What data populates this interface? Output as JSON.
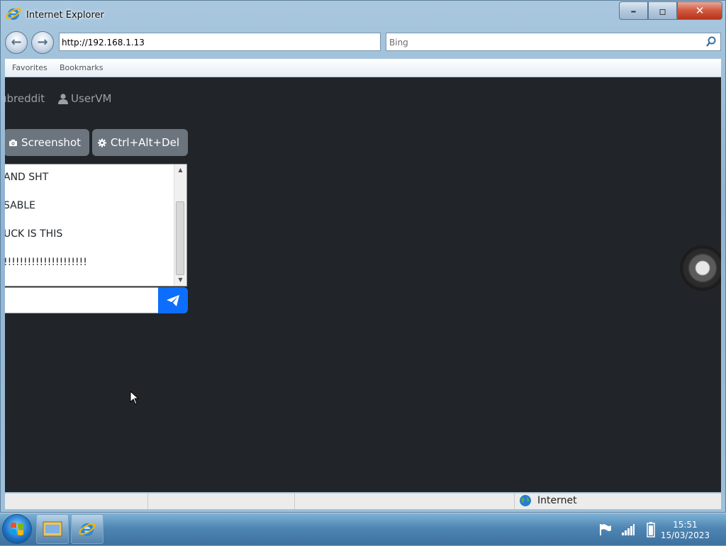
{
  "window": {
    "title": "Internet Explorer",
    "buttons": {
      "minimize": "–",
      "maximize": "▫",
      "close": "✕"
    }
  },
  "nav": {
    "back": "←",
    "forward": "→",
    "address": "http://192.168.1.13",
    "search_placeholder": "Bing"
  },
  "favorites_bar": {
    "favorites": "Favorites",
    "bookmarks": "Bookmarks"
  },
  "page": {
    "nav_links": {
      "subreddit": "ubreddit",
      "user": "UserVM"
    },
    "buttons": {
      "screenshot": "Screenshot",
      "ctrl_alt_del": "Ctrl+Alt+Del"
    },
    "messages": [
      "AND SHT",
      "SABLE",
      "UCK IS THIS",
      "!!!!!!!!!!!!!!!!!!!!!"
    ],
    "message_input_value": ""
  },
  "status_bar": {
    "zone": "Internet"
  },
  "taskbar": {
    "time": "15:51",
    "date": "15/03/2023"
  },
  "colors": {
    "page_bg": "#212529",
    "button_gray": "#6c757d",
    "send_blue": "#0d6efd"
  }
}
